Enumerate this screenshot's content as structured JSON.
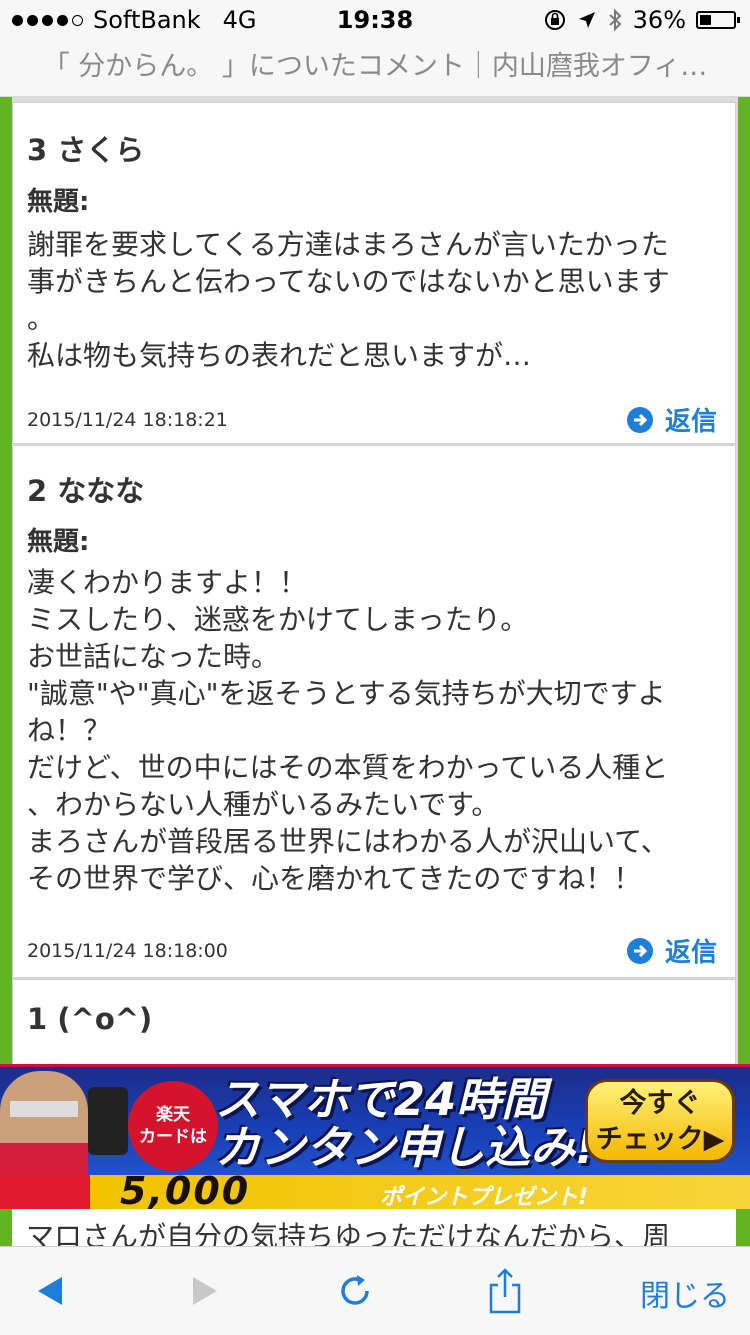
{
  "status_bar": {
    "carrier": "SoftBank",
    "network": "4G",
    "time": "19:38",
    "battery": "36%",
    "battery_level": 0.36
  },
  "url_bar": {
    "title": "「 分からん。 」についたコメント｜内山麿我オフィ…"
  },
  "comments": [
    {
      "head": "3 さくら",
      "subject": "無題:",
      "body": "謝罪を要求してくる方達はまろさんが言いたかった\n事がきちんと伝わってないのではないかと思います\n。\n私は物も気持ちの表れだと思いますが…",
      "date": "2015/11/24 18:18:21",
      "reply_label": "返信"
    },
    {
      "head": "2 ななな",
      "subject": "無題:",
      "body": "凄くわかりますよ！！\nミスしたり、迷惑をかけてしまったり。\nお世話になった時。\n\"誠意\"や\"真心\"を返そうとする気持ちが大切ですよ\nね！？\nだけど、世の中にはその本質をわかっている人種と\n、わからない人種がいるみたいです。\nまろさんが普段居る世界にはわかる人が沢山いて、\nその世界で学び、心を磨かれてきたのですね！！",
      "date": "2015/11/24 18:18:00",
      "reply_label": "返信"
    },
    {
      "head": "1 (^o^)"
    }
  ],
  "ad": {
    "badge": "楽天\nカードは",
    "headline1": "スマホで24時間",
    "headline2": "カンタン申し込み!",
    "button": "今すぐ\nチェック▶",
    "points": "5,000",
    "present": "ポイントプレゼント!"
  },
  "partial_comment": {
    "text": "マロさんが自分の気持ちゆっただけなんだから、周"
  },
  "toolbar": {
    "close_label": "閉じる"
  },
  "colors": {
    "frame_green": "#63b421",
    "link_blue": "#1f7fd6"
  }
}
